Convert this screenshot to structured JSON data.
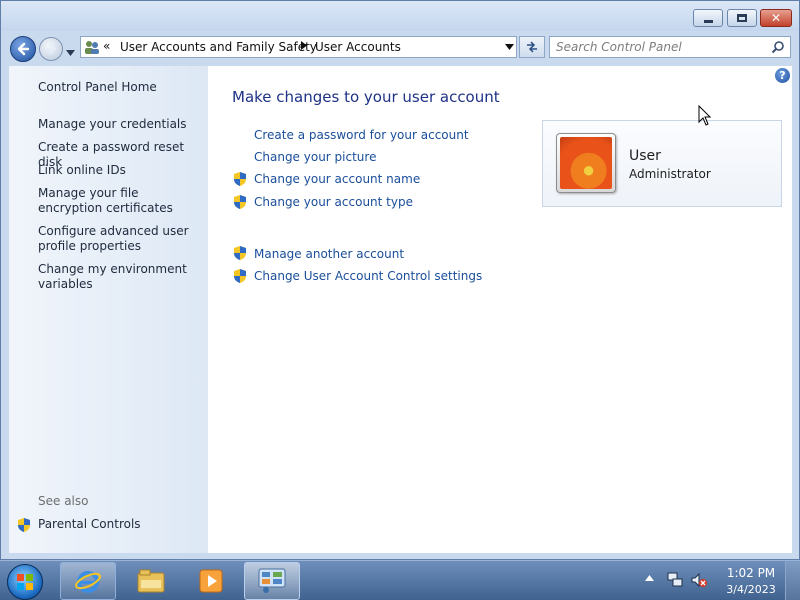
{
  "titlebar": {
    "minimize_icon": "minimize-icon",
    "maximize_icon": "maximize-icon",
    "close_icon": "close-icon",
    "close_glyph": "✕"
  },
  "navbar": {
    "breadcrumb_overflow": "«",
    "breadcrumb": [
      "User Accounts and Family Safety",
      "User Accounts"
    ],
    "search_placeholder": "Search Control Panel"
  },
  "sidebar": {
    "home": "Control Panel Home",
    "tasks": [
      "Manage your credentials",
      "Create a password reset disk",
      "Link online IDs",
      "Manage your file encryption certificates",
      "Configure advanced user profile properties",
      "Change my environment variables"
    ],
    "see_also": "See also",
    "parental_controls": "Parental Controls"
  },
  "main": {
    "help_glyph": "?",
    "title": "Make changes to your user account",
    "links_primary": [
      {
        "label": "Create a password for your account",
        "shield": false
      },
      {
        "label": "Change your picture",
        "shield": false
      },
      {
        "label": "Change your account name",
        "shield": true
      },
      {
        "label": "Change your account type",
        "shield": true
      }
    ],
    "links_secondary": [
      {
        "label": "Manage another account",
        "shield": true
      },
      {
        "label": "Change User Account Control settings",
        "shield": true
      }
    ]
  },
  "user_card": {
    "name": "User",
    "role": "Administrator"
  },
  "taskbar": {
    "apps": [
      "internet-explorer-icon",
      "windows-explorer-icon",
      "media-player-icon",
      "control-panel-icon"
    ],
    "time": "1:02 PM",
    "date": "3/4/2023"
  },
  "colors": {
    "link": "#1a4e9a",
    "title": "#1e3287",
    "window_frame": "#c9d9ee",
    "taskbar": "#40628f"
  }
}
